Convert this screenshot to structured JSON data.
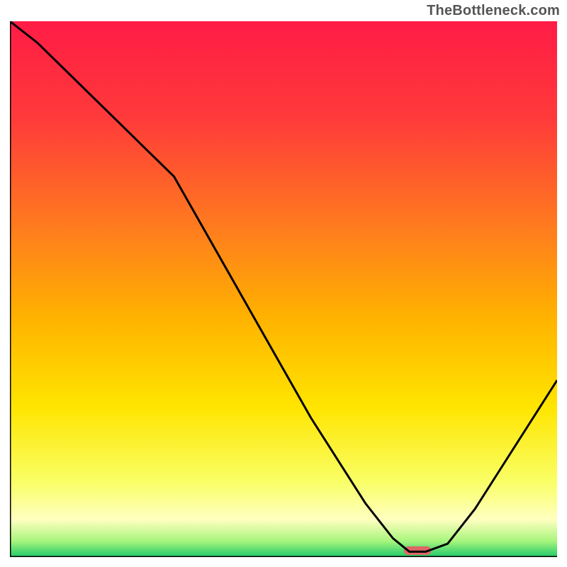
{
  "watermark": "TheBottleneck.com",
  "chart_data": {
    "type": "line",
    "title": "",
    "xlabel": "",
    "ylabel": "",
    "xlim": [
      0,
      100
    ],
    "ylim": [
      0,
      100
    ],
    "grid": false,
    "series": [
      {
        "name": "curve",
        "x": [
          0,
          5,
          10,
          15,
          20,
          25,
          30,
          35,
          40,
          45,
          50,
          55,
          60,
          65,
          70,
          73,
          76,
          80,
          85,
          90,
          95,
          100
        ],
        "y": [
          100,
          96,
          91,
          86,
          81,
          76,
          71,
          62,
          53,
          44,
          35,
          26,
          18,
          10,
          3.5,
          1.0,
          1.0,
          2.5,
          9,
          17,
          25,
          33
        ]
      }
    ],
    "annotations": [
      {
        "name": "min-marker",
        "type": "capsule",
        "x_start": 72,
        "x_end": 77,
        "y": 1.2
      }
    ],
    "background": {
      "type": "vertical-gradient",
      "stops": [
        {
          "pos": 0.0,
          "color": "#ff1c46"
        },
        {
          "pos": 0.18,
          "color": "#ff3a3a"
        },
        {
          "pos": 0.38,
          "color": "#ff7a1f"
        },
        {
          "pos": 0.55,
          "color": "#ffb100"
        },
        {
          "pos": 0.72,
          "color": "#ffe500"
        },
        {
          "pos": 0.86,
          "color": "#f9ff66"
        },
        {
          "pos": 0.93,
          "color": "#ffffc0"
        },
        {
          "pos": 0.97,
          "color": "#a8f57d"
        },
        {
          "pos": 1.0,
          "color": "#1fc96a"
        }
      ]
    }
  }
}
